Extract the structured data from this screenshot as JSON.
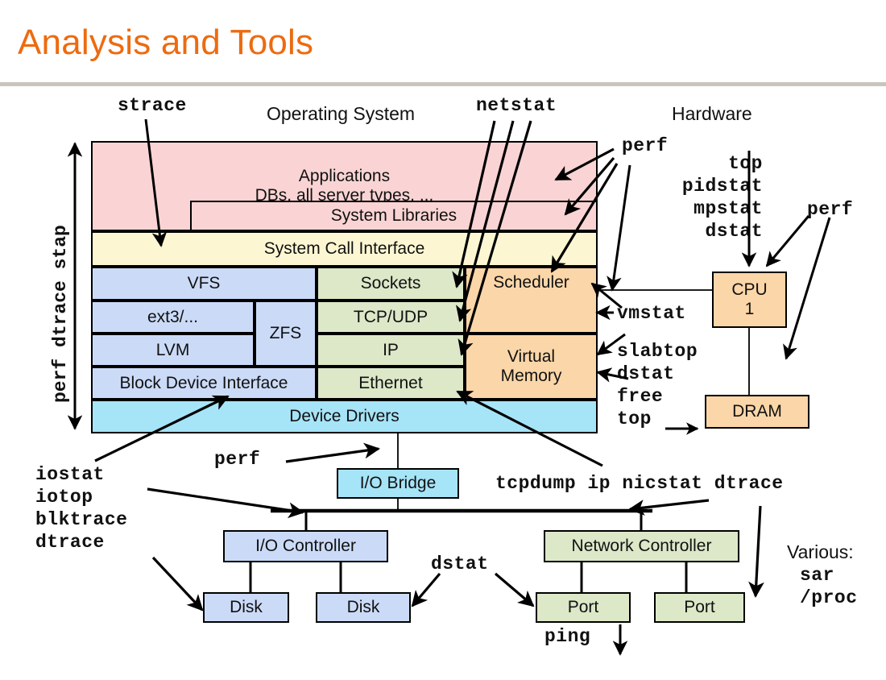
{
  "slide": {
    "title": "Analysis and Tools"
  },
  "headings": {
    "operating_system": "Operating System",
    "hardware": "Hardware"
  },
  "os_stack": {
    "applications": {
      "line1": "Applications",
      "line2": "DBs, all server types, ..."
    },
    "system_libraries": "System Libraries",
    "system_call_interface": "System Call Interface",
    "vfs": "VFS",
    "ext3": "ext3/...",
    "zfs": "ZFS",
    "lvm": "LVM",
    "block_device_interface": "Block Device Interface",
    "sockets": "Sockets",
    "tcp_udp": "TCP/UDP",
    "ip": "IP",
    "ethernet": "Ethernet",
    "scheduler": "Scheduler",
    "virtual_memory": {
      "line1": "Virtual",
      "line2": "Memory"
    },
    "device_drivers": "Device Drivers"
  },
  "hardware": {
    "cpu": {
      "line1": "CPU",
      "line2": "1"
    },
    "dram": "DRAM",
    "io_bridge": "I/O Bridge",
    "io_controller": "I/O Controller",
    "network_controller": "Network Controller",
    "disk_left": "Disk",
    "disk_right": "Disk",
    "port_left": "Port",
    "port_right": "Port"
  },
  "tools": {
    "left_vertical": "perf dtrace stap",
    "strace": "strace",
    "netstat": "netstat",
    "perf_top": "perf",
    "top_block": "top\npidstat\nmpstat\ndstat",
    "perf_right": "perf",
    "vmstat": "vmstat",
    "mem_block": "slabtop\ndstat\nfree\ntop",
    "iostat_block": "iostat\niotop\nblktrace\ndtrace",
    "perf_bridge": "perf",
    "tcpdump_line": "tcpdump ip nicstat dtrace",
    "dstat_bottom": "dstat",
    "ping": "ping",
    "various_label": "Various:",
    "various_tools": "sar\n/proc"
  },
  "colors": {
    "title": "#ED6B10",
    "rule": "#C9C5BD",
    "applications": "#FAD4D4",
    "syscall": "#FCF7D2",
    "filesystem": "#CBDBF7",
    "network": "#DCE8C8",
    "memory_cpu": "#FBD6A8",
    "drivers": "#A6E4F7",
    "stroke": "#000000"
  }
}
